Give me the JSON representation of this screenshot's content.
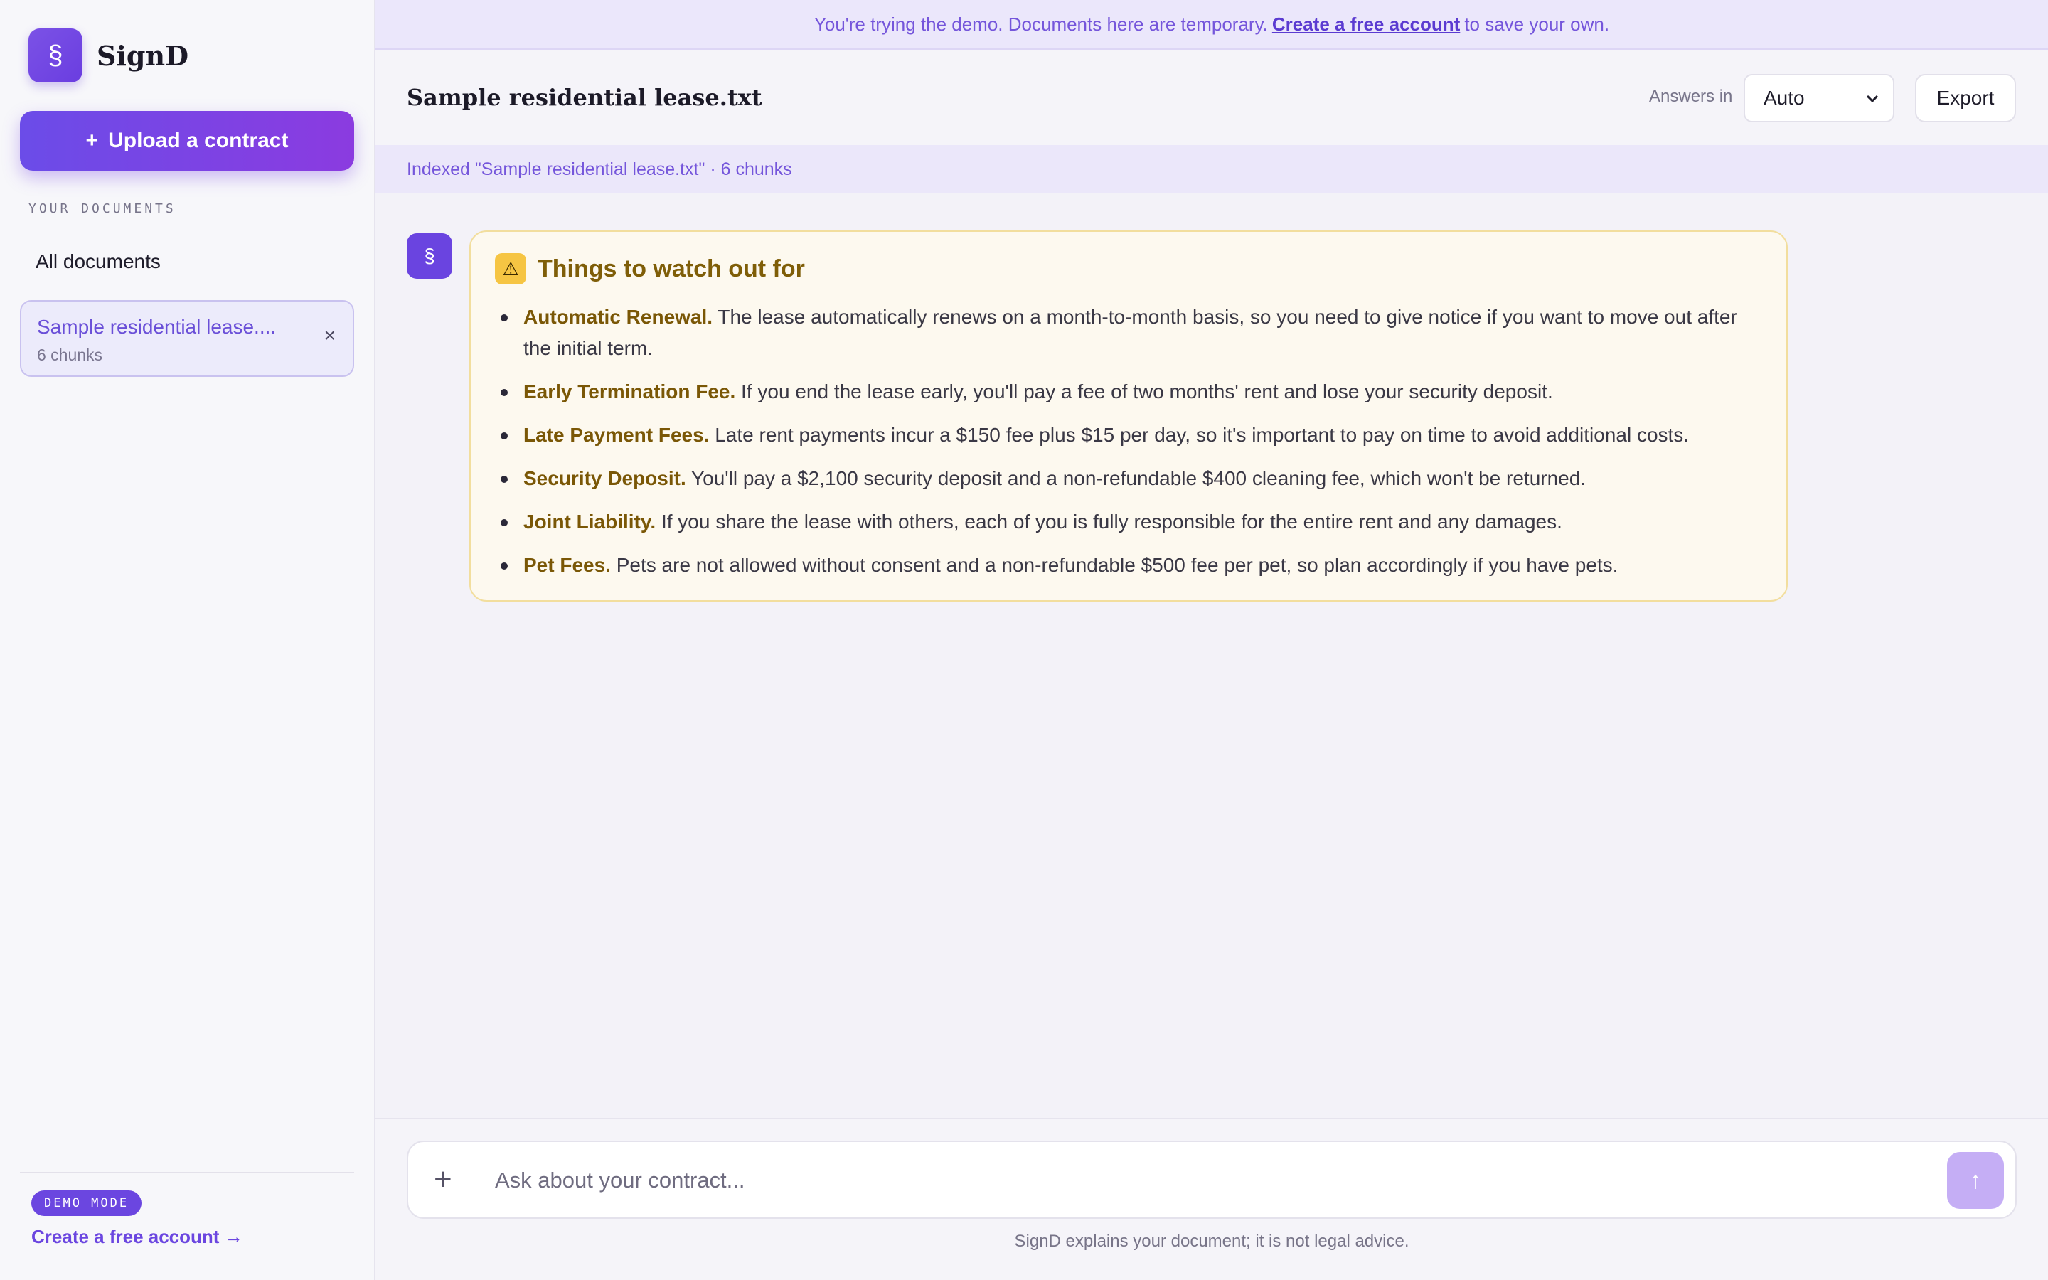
{
  "brand": {
    "logo": "§",
    "name": "SignD"
  },
  "sidebar": {
    "upload_label": "Upload a contract",
    "upload_icon": "+",
    "section_label": "YOUR DOCUMENTS",
    "all_documents": "All documents",
    "document": {
      "title": "Sample residential lease....",
      "meta": "6 chunks",
      "close": "×"
    },
    "demo_badge": "DEMO MODE",
    "create_account": "Create a free account →"
  },
  "banner": {
    "prefix": "You're trying the demo. Documents here are temporary.",
    "link": "Create a free account",
    "suffix": "to save your own."
  },
  "header": {
    "title": "Sample residential lease.txt",
    "answers_label": "Answers in",
    "language_selected": "Auto",
    "export_label": "Export"
  },
  "indexed_text": "Indexed \"Sample residential lease.txt\" · 6 chunks",
  "message": {
    "avatar": "§",
    "warn_icon": "⚠",
    "title": "Things to watch out for",
    "items": [
      {
        "term": "Automatic Renewal.",
        "text": "The lease automatically renews on a month-to-month basis, so you need to give notice if you want to move out after the initial term."
      },
      {
        "term": "Early Termination Fee.",
        "text": "If you end the lease early, you'll pay a fee of two months' rent and lose your security deposit."
      },
      {
        "term": "Late Payment Fees.",
        "text": "Late rent payments incur a $150 fee plus $15 per day, so it's important to pay on time to avoid additional costs."
      },
      {
        "term": "Security Deposit.",
        "text": "You'll pay a $2,100 security deposit and a non-refundable $400 cleaning fee, which won't be returned."
      },
      {
        "term": "Joint Liability.",
        "text": "If you share the lease with others, each of you is fully responsible for the entire rent and any damages."
      },
      {
        "term": "Pet Fees.",
        "text": "Pets are not allowed without consent and a non-refundable $500 fee per pet, so plan accordingly if you have pets."
      }
    ]
  },
  "composer": {
    "plus": "+",
    "placeholder": "Ask about your contract...",
    "send_icon": "↑",
    "disclaimer": "SignD explains your document; it is not legal advice."
  },
  "colors": {
    "accent": "#6b46e0",
    "warning_bg": "#fdf9ef",
    "warning_text": "#7a5706"
  }
}
